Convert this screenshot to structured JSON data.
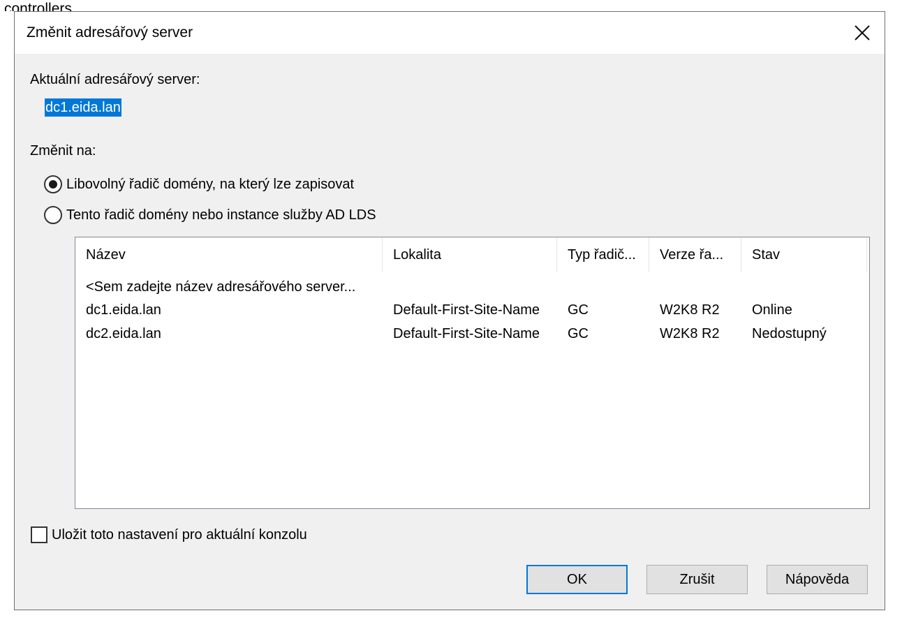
{
  "background": {
    "text": "controllers"
  },
  "dialog": {
    "title": "Změnit adresářový server",
    "current_server_label": "Aktuální adresářový server:",
    "current_server_value": "dc1.eida.lan",
    "change_to_label": "Změnit na:",
    "options": [
      {
        "label": "Libovolný řadič domény, na který lze zapisovat",
        "checked": true
      },
      {
        "label": "Tento řadič domény nebo instance služby AD LDS",
        "checked": false
      }
    ],
    "table": {
      "columns": [
        "Název",
        "Lokalita",
        "Typ řadič...",
        "Verze řa...",
        "Stav"
      ],
      "placeholder_row": "<Sem zadejte název adresářového server...",
      "rows": [
        [
          "dc1.eida.lan",
          "Default-First-Site-Name",
          "GC",
          "W2K8 R2",
          "Online"
        ],
        [
          "dc2.eida.lan",
          "Default-First-Site-Name",
          "GC",
          "W2K8 R2",
          "Nedostupný"
        ]
      ]
    },
    "save_setting_label": "Uložit toto nastavení pro aktuální konzolu",
    "save_setting_checked": false,
    "buttons": {
      "ok": "OK",
      "cancel": "Zrušit",
      "help": "Nápověda"
    }
  },
  "colors": {
    "dialog_bg": "#f0f0f0",
    "selection": "#0078d7",
    "default_button_border": "#0078d7"
  }
}
